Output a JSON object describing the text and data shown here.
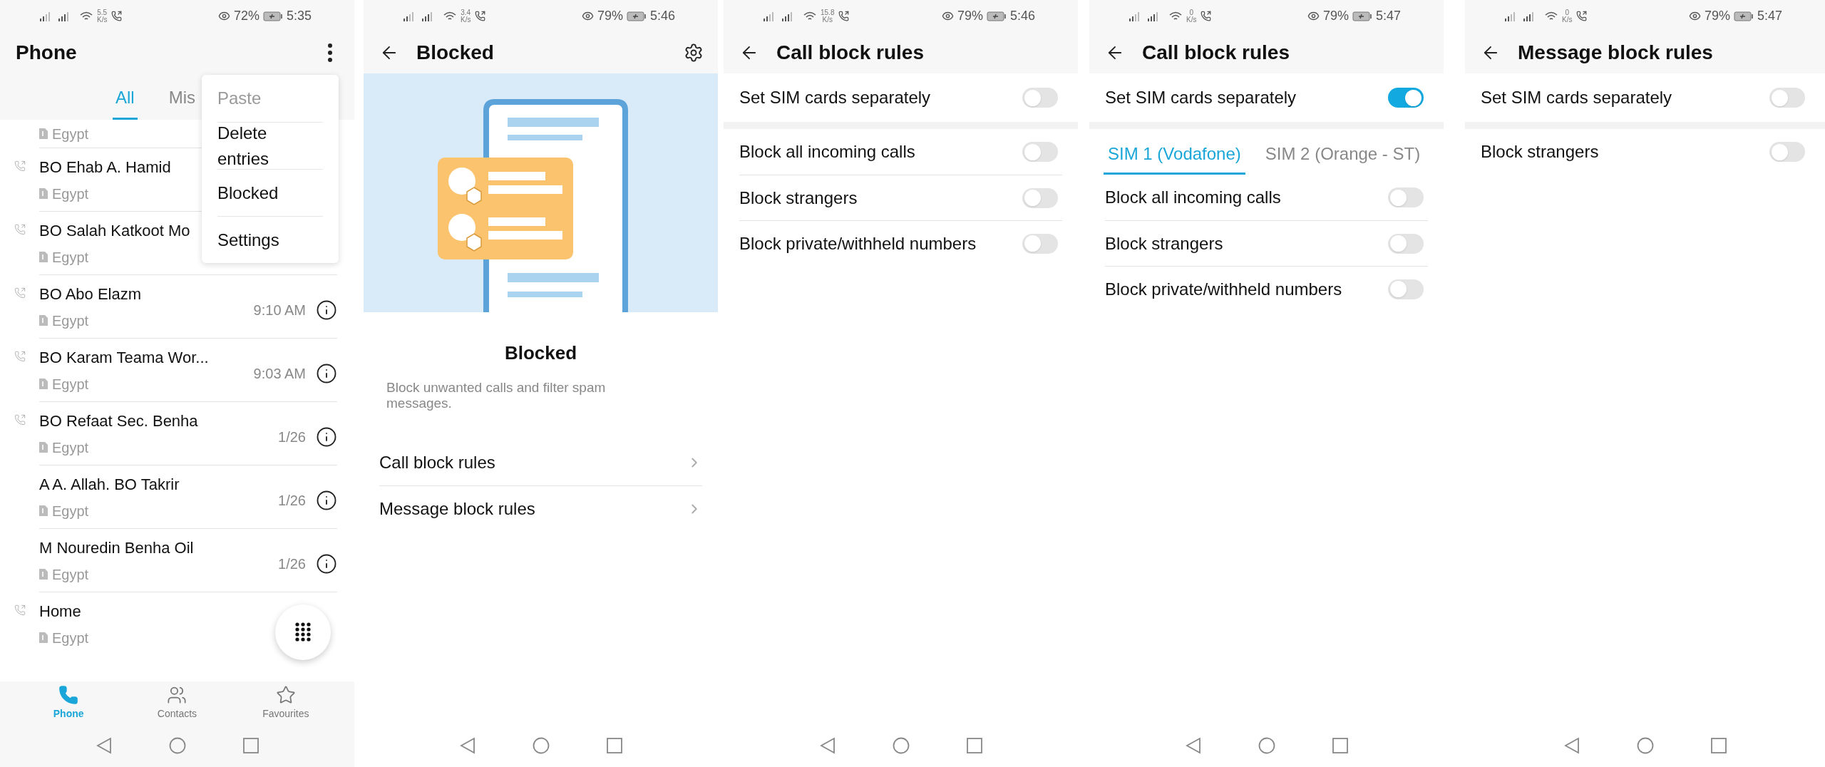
{
  "screens": [
    {
      "kind": "call_log",
      "status_bar": {
        "speed": "5.5",
        "speed_unit": "K/s",
        "battery": "72%",
        "time": "5:35"
      },
      "title": "Phone",
      "tabs": [
        {
          "label": "All",
          "selected": true
        },
        {
          "label": "Mis",
          "selected": false
        }
      ],
      "calls": [
        {
          "location": "Egypt",
          "recent_call": false,
          "info": false
        },
        {
          "name": "BO Ehab A. Hamid",
          "location": "Egypt",
          "recent_call": true,
          "info": false
        },
        {
          "name": "BO Salah Katkoot Mo",
          "location": "Egypt",
          "recent_call": true,
          "info": false
        },
        {
          "name": "BO Abo Elazm",
          "location": "Egypt",
          "time": "9:10 AM",
          "recent_call": true,
          "info": true
        },
        {
          "name": "BO Karam Teama Wor...",
          "location": "Egypt",
          "time": "9:03 AM",
          "recent_call": true,
          "info": true
        },
        {
          "name": "BO Refaat Sec. Benha",
          "location": "Egypt",
          "time": "1/26",
          "recent_call": true,
          "info": true
        },
        {
          "name": "A A. Allah. BO Takrir",
          "location": "Egypt",
          "time": "1/26",
          "recent_call": false,
          "info": true
        },
        {
          "name": "M Nouredin Benha Oil",
          "location": "Egypt",
          "time": "1/26",
          "recent_call": false,
          "info": true
        },
        {
          "name": "Home",
          "location": "Egypt",
          "recent_call": true,
          "info": false
        }
      ],
      "menu": [
        {
          "label": "Paste",
          "disabled": true
        },
        {
          "label": "Delete entries",
          "disabled": false
        },
        {
          "label": "Blocked",
          "disabled": false
        },
        {
          "label": "Settings",
          "disabled": false
        }
      ],
      "bottom_nav": [
        {
          "label": "Phone",
          "kind": "phone",
          "selected": true
        },
        {
          "label": "Contacts",
          "kind": "contacts",
          "selected": false
        },
        {
          "label": "Favourites",
          "kind": "star",
          "selected": false
        }
      ]
    },
    {
      "kind": "blocked",
      "status_bar": {
        "speed": "3.4",
        "speed_unit": "K/s",
        "battery": "79%",
        "time": "5:46"
      },
      "title": "Blocked",
      "heading": "Blocked",
      "description": "Block unwanted calls and filter spam messages.",
      "links": [
        "Call block rules",
        "Message block rules"
      ]
    },
    {
      "kind": "rules",
      "status_bar": {
        "speed": "15.8",
        "speed_unit": "K/s",
        "battery": "79%",
        "time": "5:46"
      },
      "title": "Call block rules",
      "sim_toggle": {
        "label": "Set SIM cards separately",
        "on": false
      },
      "rules": [
        {
          "label": "Block all incoming calls",
          "on": false
        },
        {
          "label": "Block strangers",
          "on": false
        },
        {
          "label": "Block private/withheld numbers",
          "on": false
        }
      ]
    },
    {
      "kind": "rules",
      "status_bar": {
        "speed": "0",
        "speed_unit": "K/s",
        "battery": "79%",
        "time": "5:47"
      },
      "title": "Call block rules",
      "sim_toggle": {
        "label": "Set SIM cards separately",
        "on": true
      },
      "sim_tabs": [
        {
          "label": "SIM 1 (Vodafone)",
          "selected": true
        },
        {
          "label": "SIM 2 (Orange - ST)",
          "selected": false
        }
      ],
      "rules": [
        {
          "label": "Block all incoming calls",
          "on": false
        },
        {
          "label": "Block strangers",
          "on": false
        },
        {
          "label": "Block private/withheld numbers",
          "on": false
        }
      ]
    },
    {
      "kind": "rules",
      "status_bar": {
        "speed": "0",
        "speed_unit": "K/s",
        "battery": "79%",
        "time": "5:47"
      },
      "title": "Message block rules",
      "sim_toggle": {
        "label": "Set SIM cards separately",
        "on": false
      },
      "rules": [
        {
          "label": "Block strangers",
          "on": false
        }
      ]
    }
  ]
}
